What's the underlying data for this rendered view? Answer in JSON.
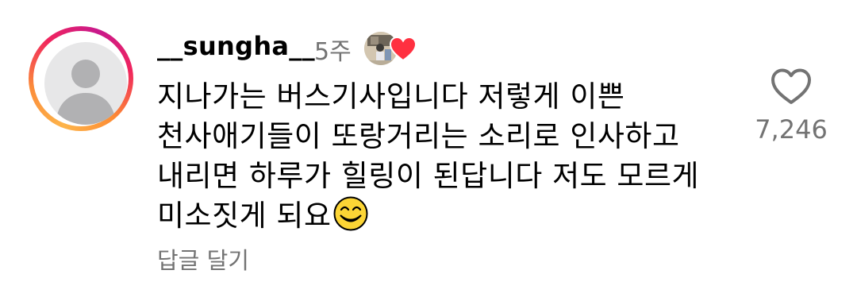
{
  "comment": {
    "username": "__sungha__",
    "time_ago": "5주",
    "text": "지나가는 버스기사입니다 저렇게 이쁜\n천사애기들이 또랑거리는 소리로 인사하고\n내리면 하루가 힐링이 된답니다 저도 모르게\n미소짓게 되요",
    "emoji": "grinning-face-with-smiling-eyes",
    "reply_label": "답글 달기",
    "like_count": "7,246",
    "like_icon": "heart-outline-icon",
    "creator_liked_icon": "heart-filled-icon",
    "colors": {
      "secondary_text": "#737373",
      "heart_red": "#ff3040",
      "story_ring": [
        "#fdb44a",
        "#f0245e",
        "#c8198c"
      ]
    }
  }
}
